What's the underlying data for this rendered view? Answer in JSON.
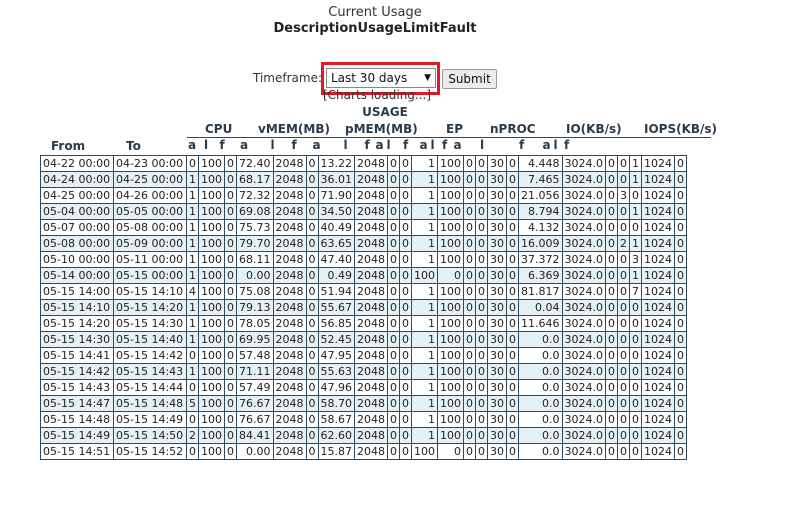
{
  "header": {
    "title": "Current Usage",
    "subtitle": "DescriptionUsageLimitFault"
  },
  "timeframe": {
    "label": "Timeframe:",
    "selected": "Last 30 days",
    "submit_label": "Submit"
  },
  "loading_text": "[Charts loading...]",
  "usage_heading": "USAGE",
  "columns": {
    "from": "From",
    "to": "To",
    "groups": [
      "CPU",
      "vMEM(MB)",
      "pMEM(MB)",
      "EP",
      "nPROC",
      "IO(KB/s)",
      "IOPS(KB/s)"
    ],
    "sub": [
      "a",
      "l",
      "f"
    ]
  },
  "rows": [
    [
      "04-22 00:00",
      "04-23 00:00",
      "0",
      "100",
      "0",
      "72.40",
      "2048",
      "0",
      "13.22",
      "2048",
      "0",
      "0",
      "1",
      "100",
      "0",
      "0",
      "30",
      "0",
      "4.448",
      "3024.0",
      "0",
      "0",
      "1",
      "1024",
      "0"
    ],
    [
      "04-24 00:00",
      "04-25 00:00",
      "1",
      "100",
      "0",
      "68.17",
      "2048",
      "0",
      "36.01",
      "2048",
      "0",
      "0",
      "1",
      "100",
      "0",
      "0",
      "30",
      "0",
      "7.465",
      "3024.0",
      "0",
      "0",
      "1",
      "1024",
      "0"
    ],
    [
      "04-25 00:00",
      "04-26 00:00",
      "1",
      "100",
      "0",
      "72.32",
      "2048",
      "0",
      "71.90",
      "2048",
      "0",
      "0",
      "1",
      "100",
      "0",
      "0",
      "30",
      "0",
      "21.056",
      "3024.0",
      "0",
      "3",
      "0",
      "1024",
      "0"
    ],
    [
      "05-04 00:00",
      "05-05 00:00",
      "1",
      "100",
      "0",
      "69.08",
      "2048",
      "0",
      "34.50",
      "2048",
      "0",
      "0",
      "1",
      "100",
      "0",
      "0",
      "30",
      "0",
      "8.794",
      "3024.0",
      "0",
      "0",
      "1",
      "1024",
      "0"
    ],
    [
      "05-07 00:00",
      "05-08 00:00",
      "1",
      "100",
      "0",
      "75.73",
      "2048",
      "0",
      "40.49",
      "2048",
      "0",
      "0",
      "1",
      "100",
      "0",
      "0",
      "30",
      "0",
      "4.132",
      "3024.0",
      "0",
      "0",
      "0",
      "1024",
      "0"
    ],
    [
      "05-08 00:00",
      "05-09 00:00",
      "1",
      "100",
      "0",
      "79.70",
      "2048",
      "0",
      "63.65",
      "2048",
      "0",
      "0",
      "1",
      "100",
      "0",
      "0",
      "30",
      "0",
      "16.009",
      "3024.0",
      "0",
      "2",
      "1",
      "1024",
      "0"
    ],
    [
      "05-10 00:00",
      "05-11 00:00",
      "1",
      "100",
      "0",
      "68.11",
      "2048",
      "0",
      "47.40",
      "2048",
      "0",
      "0",
      "1",
      "100",
      "0",
      "0",
      "30",
      "0",
      "37.372",
      "3024.0",
      "0",
      "0",
      "3",
      "1024",
      "0"
    ],
    [
      "05-14 00:00",
      "05-15 00:00",
      "1",
      "100",
      "0",
      "0.00",
      "2048",
      "0",
      "0.49",
      "2048",
      "0",
      "0",
      "100",
      "0",
      "0",
      "0",
      "30",
      "0",
      "6.369",
      "3024.0",
      "0",
      "0",
      "1",
      "1024",
      "0"
    ],
    [
      "05-15 14:00",
      "05-15 14:10",
      "4",
      "100",
      "0",
      "75.08",
      "2048",
      "0",
      "51.94",
      "2048",
      "0",
      "0",
      "1",
      "100",
      "0",
      "0",
      "30",
      "0",
      "81.817",
      "3024.0",
      "0",
      "0",
      "7",
      "1024",
      "0"
    ],
    [
      "05-15 14:10",
      "05-15 14:20",
      "1",
      "100",
      "0",
      "79.13",
      "2048",
      "0",
      "55.67",
      "2048",
      "0",
      "0",
      "1",
      "100",
      "0",
      "0",
      "30",
      "0",
      "0.04",
      "3024.0",
      "0",
      "0",
      "0",
      "1024",
      "0"
    ],
    [
      "05-15 14:20",
      "05-15 14:30",
      "1",
      "100",
      "0",
      "78.05",
      "2048",
      "0",
      "56.85",
      "2048",
      "0",
      "0",
      "1",
      "100",
      "0",
      "0",
      "30",
      "0",
      "11.646",
      "3024.0",
      "0",
      "0",
      "0",
      "1024",
      "0"
    ],
    [
      "05-15 14:30",
      "05-15 14:40",
      "1",
      "100",
      "0",
      "69.95",
      "2048",
      "0",
      "52.45",
      "2048",
      "0",
      "0",
      "1",
      "100",
      "0",
      "0",
      "30",
      "0",
      "0.0",
      "3024.0",
      "0",
      "0",
      "0",
      "1024",
      "0"
    ],
    [
      "05-15 14:41",
      "05-15 14:42",
      "0",
      "100",
      "0",
      "57.48",
      "2048",
      "0",
      "47.95",
      "2048",
      "0",
      "0",
      "1",
      "100",
      "0",
      "0",
      "30",
      "0",
      "0.0",
      "3024.0",
      "0",
      "0",
      "0",
      "1024",
      "0"
    ],
    [
      "05-15 14:42",
      "05-15 14:43",
      "1",
      "100",
      "0",
      "71.11",
      "2048",
      "0",
      "55.63",
      "2048",
      "0",
      "0",
      "1",
      "100",
      "0",
      "0",
      "30",
      "0",
      "0.0",
      "3024.0",
      "0",
      "0",
      "0",
      "1024",
      "0"
    ],
    [
      "05-15 14:43",
      "05-15 14:44",
      "0",
      "100",
      "0",
      "57.49",
      "2048",
      "0",
      "47.96",
      "2048",
      "0",
      "0",
      "1",
      "100",
      "0",
      "0",
      "30",
      "0",
      "0.0",
      "3024.0",
      "0",
      "0",
      "0",
      "1024",
      "0"
    ],
    [
      "05-15 14:47",
      "05-15 14:48",
      "5",
      "100",
      "0",
      "76.67",
      "2048",
      "0",
      "58.70",
      "2048",
      "0",
      "0",
      "1",
      "100",
      "0",
      "0",
      "30",
      "0",
      "0.0",
      "3024.0",
      "0",
      "0",
      "0",
      "1024",
      "0"
    ],
    [
      "05-15 14:48",
      "05-15 14:49",
      "0",
      "100",
      "0",
      "76.67",
      "2048",
      "0",
      "58.67",
      "2048",
      "0",
      "0",
      "1",
      "100",
      "0",
      "0",
      "30",
      "0",
      "0.0",
      "3024.0",
      "0",
      "0",
      "0",
      "1024",
      "0"
    ],
    [
      "05-15 14:49",
      "05-15 14:50",
      "2",
      "100",
      "0",
      "84.41",
      "2048",
      "0",
      "62.60",
      "2048",
      "0",
      "0",
      "1",
      "100",
      "0",
      "0",
      "30",
      "0",
      "0.0",
      "3024.0",
      "0",
      "0",
      "0",
      "1024",
      "0"
    ],
    [
      "05-15 14:51",
      "05-15 14:52",
      "0",
      "100",
      "0",
      "0.00",
      "2048",
      "0",
      "15.87",
      "2048",
      "0",
      "0",
      "100",
      "0",
      "0",
      "0",
      "30",
      "0",
      "0.0",
      "3024.0",
      "0",
      "0",
      "0",
      "1024",
      "0"
    ]
  ],
  "colors": {
    "highlight": "#e01a24",
    "border": "#2d4a5e",
    "stripe": "#e6f0f7",
    "heading": "#2a3b4c"
  }
}
